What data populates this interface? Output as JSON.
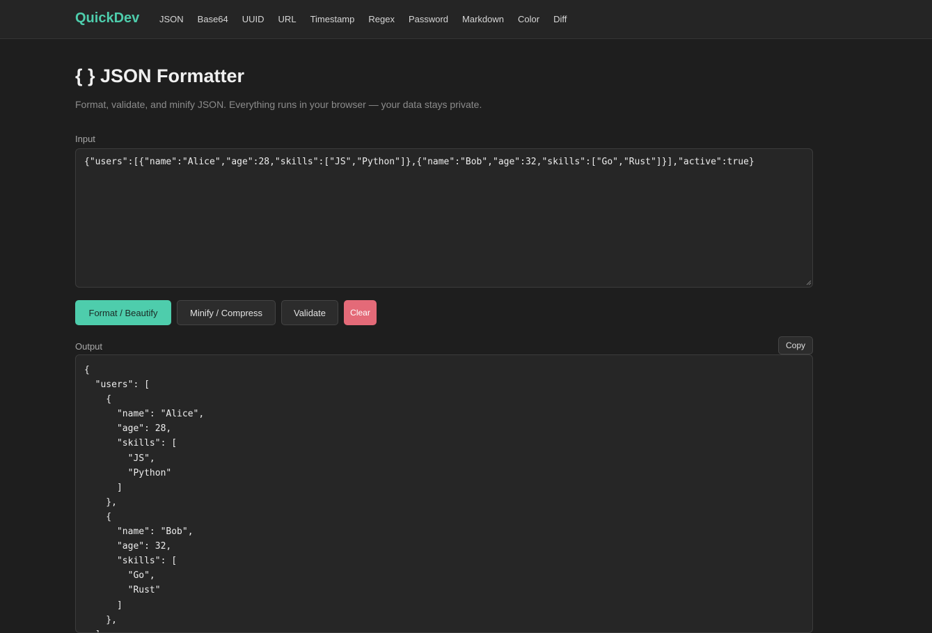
{
  "header": {
    "brand": "QuickDev",
    "nav": [
      {
        "label": "JSON"
      },
      {
        "label": "Base64"
      },
      {
        "label": "UUID"
      },
      {
        "label": "URL"
      },
      {
        "label": "Timestamp"
      },
      {
        "label": "Regex"
      },
      {
        "label": "Password"
      },
      {
        "label": "Markdown"
      },
      {
        "label": "Color"
      },
      {
        "label": "Diff"
      }
    ]
  },
  "page": {
    "title": "{ } JSON Formatter",
    "subtitle": "Format, validate, and minify JSON. Everything runs in your browser — your data stays private."
  },
  "input": {
    "label": "Input",
    "value": "{\"users\":[{\"name\":\"Alice\",\"age\":28,\"skills\":[\"JS\",\"Python\"]},{\"name\":\"Bob\",\"age\":32,\"skills\":[\"Go\",\"Rust\"]}],\"active\":true}"
  },
  "actions": {
    "format": "Format / Beautify",
    "minify": "Minify / Compress",
    "validate": "Validate",
    "clear": "Clear"
  },
  "output": {
    "label": "Output",
    "copy": "Copy",
    "text": "{\n  \"users\": [\n    {\n      \"name\": \"Alice\",\n      \"age\": 28,\n      \"skills\": [\n        \"JS\",\n        \"Python\"\n      ]\n    },\n    {\n      \"name\": \"Bob\",\n      \"age\": 32,\n      \"skills\": [\n        \"Go\",\n        \"Rust\"\n      ]\n    },\n  ],\n  \"active\": true\n}"
  },
  "colors": {
    "accent": "#4ecdac",
    "danger": "#e46a78",
    "background": "#1e1e1e",
    "panel": "#262626"
  },
  "icons": {
    "resize_grip": "resize-grip-icon"
  }
}
